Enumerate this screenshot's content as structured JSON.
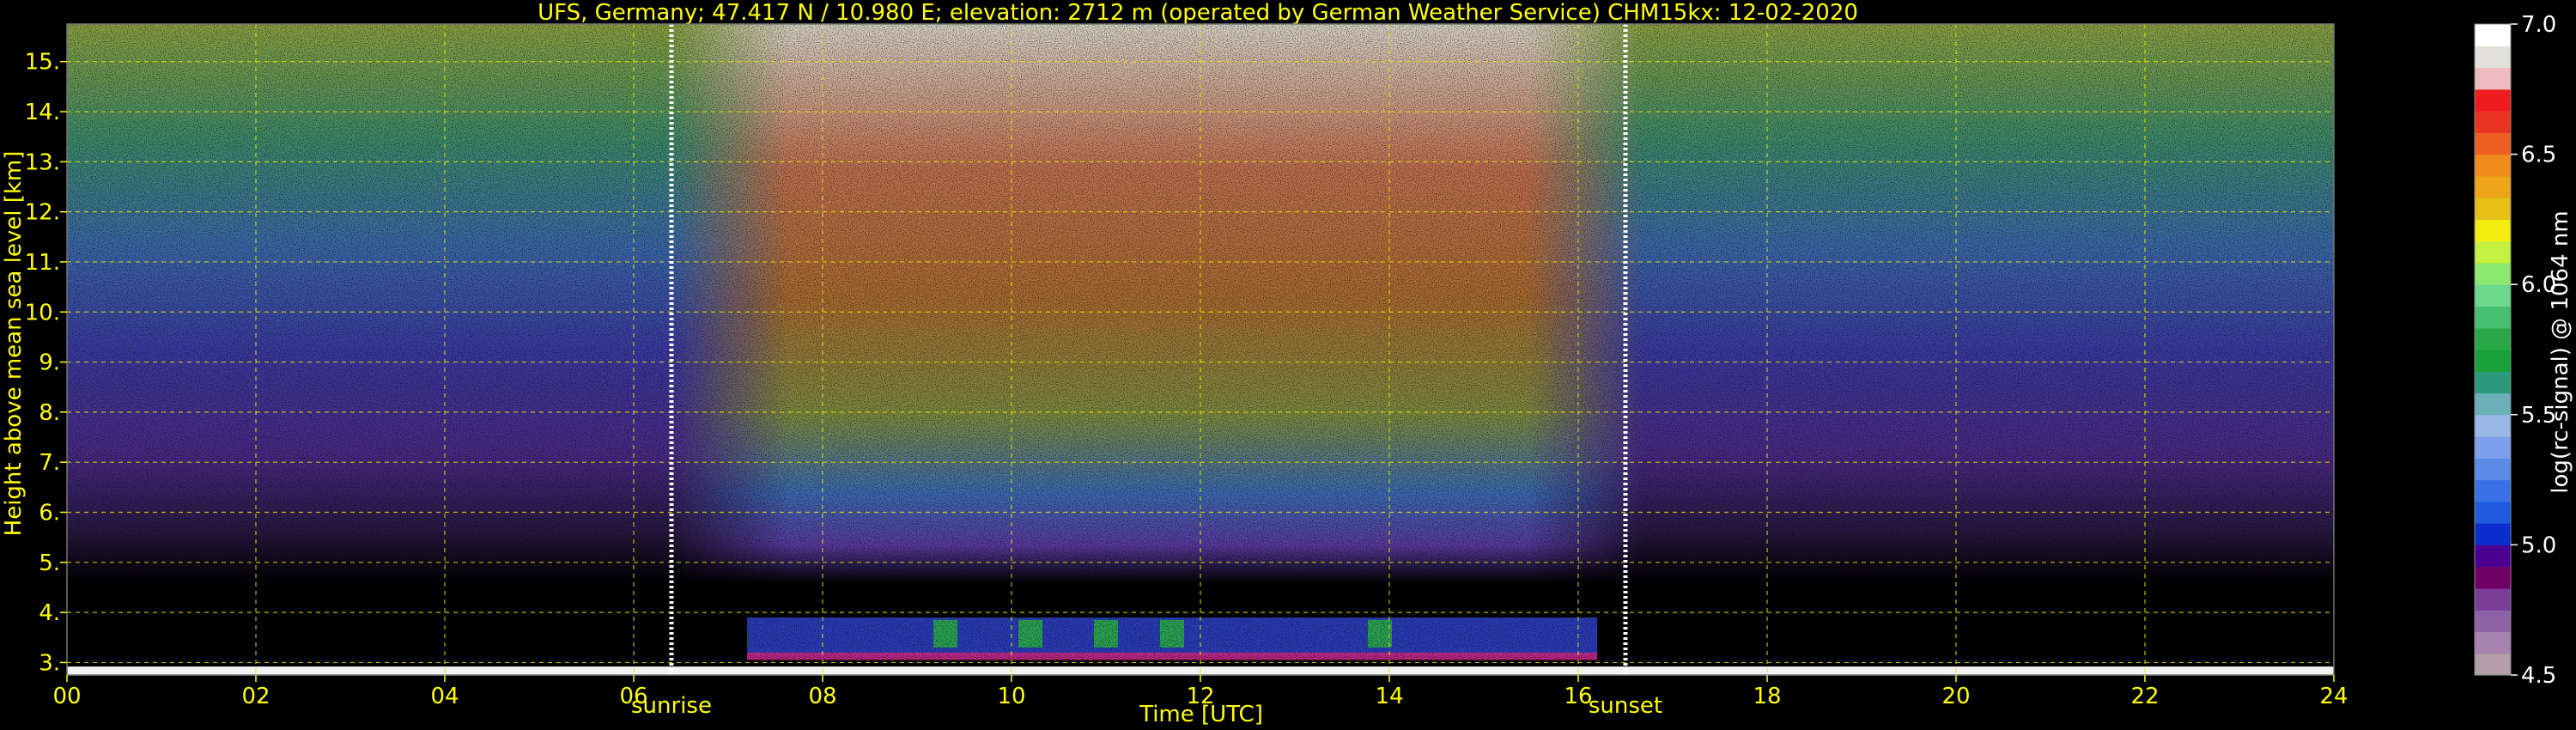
{
  "chart_data": {
    "type": "heatmap",
    "title": "UFS, Germany; 47.417 N / 10.980 E; elevation: 2712 m  (operated by German Weather Service)    CHM15kx: 12-02-2020",
    "xlabel": "Time [UTC]",
    "ylabel": "Height above mean sea level [km]",
    "xlim": [
      0,
      24
    ],
    "ylim": [
      2.75,
      15.75
    ],
    "x_ticks": [
      0,
      2,
      4,
      6,
      8,
      10,
      12,
      14,
      16,
      18,
      20,
      22,
      24
    ],
    "x_tick_labels": [
      "00",
      "02",
      "04",
      "06",
      "08",
      "10",
      "12",
      "14",
      "16",
      "18",
      "20",
      "22",
      "24"
    ],
    "y_ticks": [
      3,
      4,
      5,
      6,
      7,
      8,
      9,
      10,
      11,
      12,
      13,
      14,
      15
    ],
    "y_tick_labels": [
      "3.",
      "4.",
      "5.",
      "6.",
      "7.",
      "8.",
      "9.",
      "10.",
      "11.",
      "12.",
      "13.",
      "14.",
      "15."
    ],
    "grid": true,
    "grid_color": "#e8e800",
    "text_color": "#ffff00",
    "events": [
      {
        "label": "sunrise",
        "time": 6.4
      },
      {
        "label": "sunset",
        "time": 16.5
      }
    ],
    "colorbar": {
      "label": "log(rc-signal) @ 1064 nm",
      "range": [
        4.5,
        7.0
      ],
      "tick_values": [
        4.5,
        5.0,
        5.5,
        6.0,
        6.5,
        7.0
      ],
      "tick_labels": [
        "4.5",
        "5.0",
        "5.5",
        "6.0",
        "6.5",
        "7.0"
      ],
      "colors": [
        "#b49ea8",
        "#a684ae",
        "#8e62a6",
        "#7a3e98",
        "#700064",
        "#4a0090",
        "#0c2ecc",
        "#1e5adc",
        "#3a72e6",
        "#5a8ce8",
        "#7ea0ea",
        "#9ab8e6",
        "#6ab0b6",
        "#2a9a7a",
        "#18a03a",
        "#2aa848",
        "#46c070",
        "#6cd88a",
        "#8ce86e",
        "#c4f040",
        "#f4ee10",
        "#e8c01a",
        "#eea618",
        "#f08c1c",
        "#ec6022",
        "#e83420",
        "#ee1c1c",
        "#ecbcc0",
        "#e2e2da",
        "#ffffff"
      ]
    }
  }
}
